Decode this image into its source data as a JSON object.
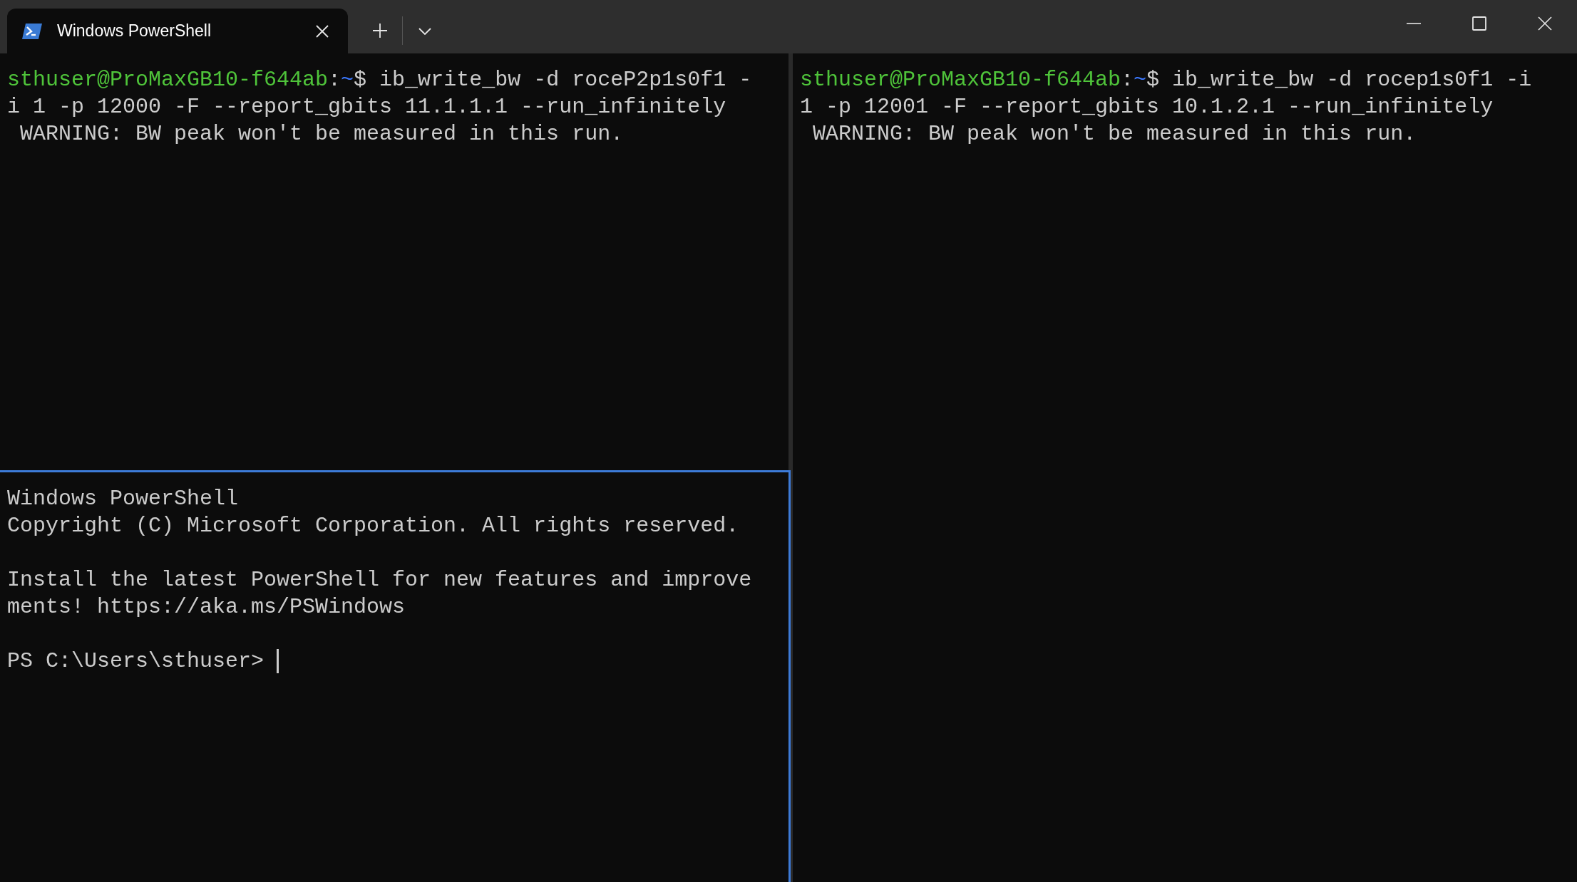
{
  "tabs": [
    {
      "title": "Windows PowerShell",
      "selected": true
    }
  ],
  "panes": [
    {
      "focused": false,
      "paragraphs": [
        {
          "lines": [
            {
              "segments": [
                {
                  "kind": "user",
                  "text": "sthuser@ProMaxGB10-f644ab"
                },
                {
                  "kind": "plain",
                  "text": ":"
                },
                {
                  "kind": "path",
                  "text": "~"
                },
                {
                  "kind": "plain",
                  "text": "$ ib_write_bw -d roceP2p1s0f1 -"
                }
              ]
            },
            {
              "segments": [
                {
                  "kind": "plain",
                  "text": "i 1 -p 12000 -F --report_gbits 11.1.1.1 --run_infinitely"
                }
              ]
            },
            {
              "segments": [
                {
                  "kind": "plain",
                  "text": " WARNING: BW peak won't be measured in this run."
                }
              ]
            }
          ]
        }
      ]
    },
    {
      "focused": false,
      "paragraphs": [
        {
          "lines": [
            {
              "segments": [
                {
                  "kind": "user",
                  "text": "sthuser@ProMaxGB10-f644ab"
                },
                {
                  "kind": "plain",
                  "text": ":"
                },
                {
                  "kind": "path",
                  "text": "~"
                },
                {
                  "kind": "plain",
                  "text": "$ ib_write_bw -d rocep1s0f1 -i"
                }
              ]
            },
            {
              "segments": [
                {
                  "kind": "plain",
                  "text": "1 -p 12001 -F --report_gbits 10.1.2.1 --run_infinitely"
                }
              ]
            },
            {
              "segments": [
                {
                  "kind": "plain",
                  "text": " WARNING: BW peak won't be measured in this run."
                }
              ]
            }
          ]
        }
      ]
    },
    {
      "focused": true,
      "paragraphs": [
        {
          "lines": [
            {
              "segments": [
                {
                  "kind": "plain",
                  "text": "Windows PowerShell"
                }
              ]
            },
            {
              "segments": [
                {
                  "kind": "plain",
                  "text": "Copyright (C) Microsoft Corporation. All rights reserved."
                }
              ]
            }
          ]
        },
        {
          "lines": [
            {
              "segments": [
                {
                  "kind": "plain",
                  "text": "Install the latest PowerShell for new features and improve"
                }
              ]
            },
            {
              "segments": [
                {
                  "kind": "plain",
                  "text": "ments! https://aka.ms/PSWindows"
                }
              ]
            }
          ]
        },
        {
          "lines": [
            {
              "segments": [
                {
                  "kind": "plain",
                  "text": "PS C:\\Users\\sthuser> "
                }
              ]
            }
          ]
        }
      ]
    }
  ]
}
